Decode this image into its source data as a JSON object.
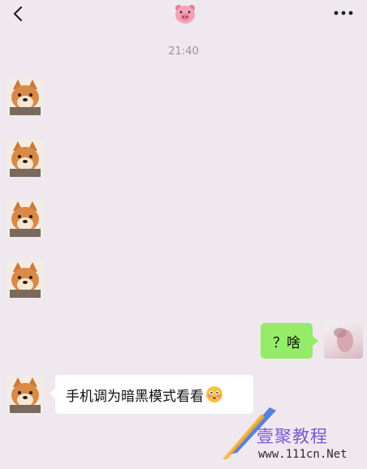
{
  "header": {
    "back_icon": "chevron-left-icon",
    "title_icon": "pig-face-emoji",
    "more_icon": "ellipsis-icon"
  },
  "chat": {
    "timestamp": "21:40",
    "messages": [
      {
        "side": "left",
        "type": "sticker",
        "content": "shiba-dog-avatar"
      },
      {
        "side": "left",
        "type": "sticker",
        "content": "shiba-dog-avatar"
      },
      {
        "side": "left",
        "type": "sticker",
        "content": "shiba-dog-avatar"
      },
      {
        "side": "left",
        "type": "sticker",
        "content": "shiba-dog-avatar"
      },
      {
        "side": "right",
        "type": "text",
        "text": "？啥"
      },
      {
        "side": "left",
        "type": "text",
        "text": "手机调为暗黑模式看看"
      }
    ]
  },
  "watermark": {
    "brand": "壹聚教程",
    "url": "www.111cn.Net"
  },
  "colors": {
    "background": "#efe8ef",
    "bubble_self": "#95ec69",
    "bubble_other": "#ffffff",
    "watermark": "#7d5ad0"
  }
}
